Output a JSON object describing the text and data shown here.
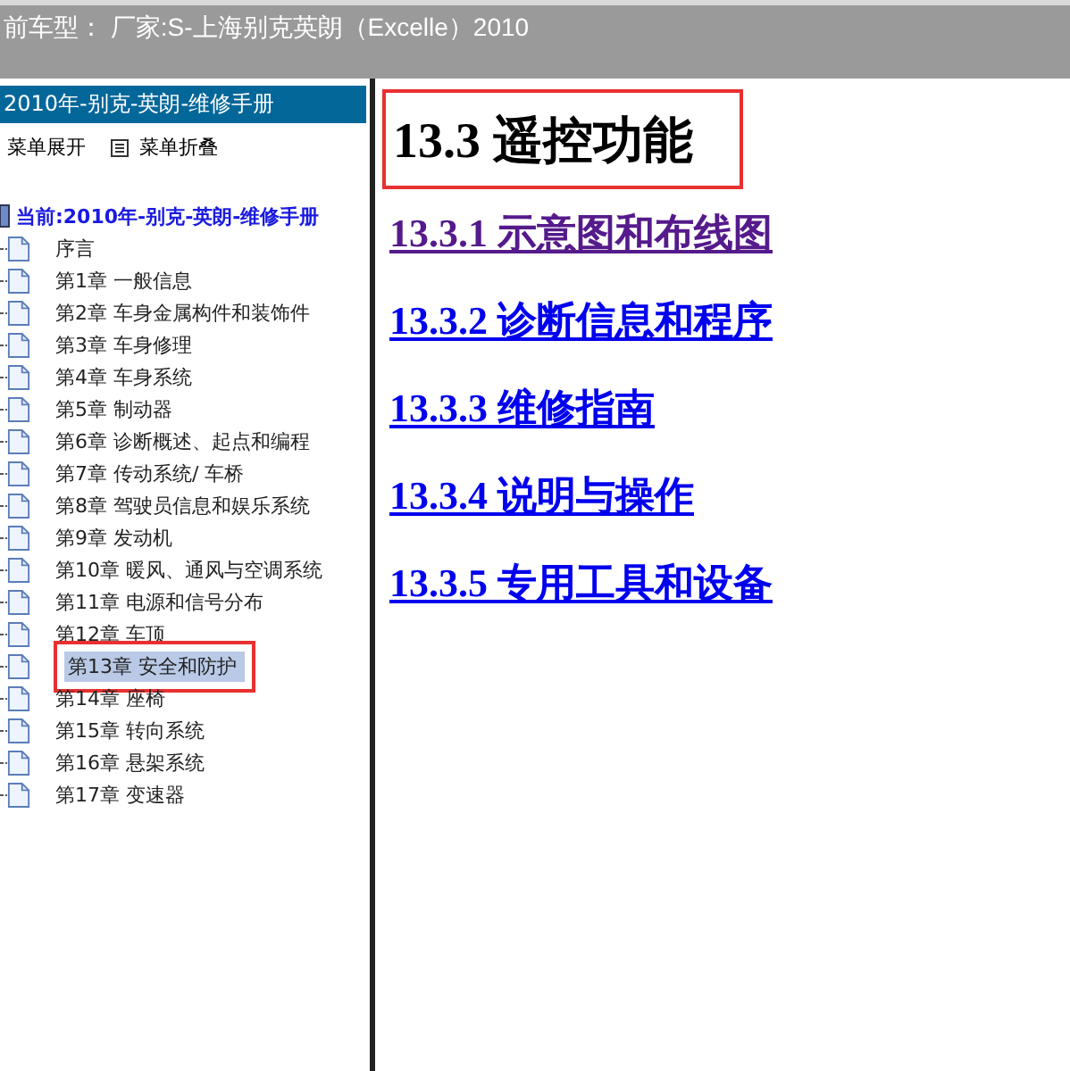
{
  "top_bar": {
    "title": "前车型： 厂家:S-上海别克英朗（Excelle）2010"
  },
  "sidebar": {
    "header": "2010年-别克-英朗-维修手册",
    "toolbar": [
      {
        "label": "菜单展开",
        "kind": "expand"
      },
      {
        "label": "菜单折叠",
        "kind": "collapse"
      }
    ],
    "root": "当前:2010年-别克-英朗-维修手册",
    "items": [
      {
        "label": "序言",
        "selected": false,
        "annotated": false
      },
      {
        "label": "第1章 一般信息",
        "selected": false,
        "annotated": false
      },
      {
        "label": "第2章 车身金属构件和装饰件",
        "selected": false,
        "annotated": false
      },
      {
        "label": "第3章 车身修理",
        "selected": false,
        "annotated": false
      },
      {
        "label": "第4章 车身系统",
        "selected": false,
        "annotated": false
      },
      {
        "label": "第5章 制动器",
        "selected": false,
        "annotated": false
      },
      {
        "label": "第6章 诊断概述、起点和编程",
        "selected": false,
        "annotated": false
      },
      {
        "label": "第7章 传动系统/ 车桥",
        "selected": false,
        "annotated": false
      },
      {
        "label": "第8章 驾驶员信息和娱乐系统",
        "selected": false,
        "annotated": false
      },
      {
        "label": "第9章 发动机",
        "selected": false,
        "annotated": false
      },
      {
        "label": "第10章 暖风、通风与空调系统",
        "selected": false,
        "annotated": false
      },
      {
        "label": "第11章 电源和信号分布",
        "selected": false,
        "annotated": false
      },
      {
        "label": "第12章 车顶",
        "selected": false,
        "annotated": false
      },
      {
        "label": "第13章 安全和防护",
        "selected": true,
        "annotated": true
      },
      {
        "label": "第14章 座椅",
        "selected": false,
        "annotated": false
      },
      {
        "label": "第15章 转向系统",
        "selected": false,
        "annotated": false
      },
      {
        "label": "第16章 悬架系统",
        "selected": false,
        "annotated": false
      },
      {
        "label": "第17章 变速器",
        "selected": false,
        "annotated": false
      }
    ]
  },
  "content": {
    "title": "13.3 遥控功能",
    "title_annotated": true,
    "links": [
      {
        "label": "13.3.1 示意图和布线图",
        "visited": true
      },
      {
        "label": "13.3.2 诊断信息和程序",
        "visited": false
      },
      {
        "label": "13.3.3 维修指南",
        "visited": false
      },
      {
        "label": "13.3.4 说明与操作",
        "visited": false
      },
      {
        "label": "13.3.5 专用工具和设备",
        "visited": false
      }
    ]
  }
}
